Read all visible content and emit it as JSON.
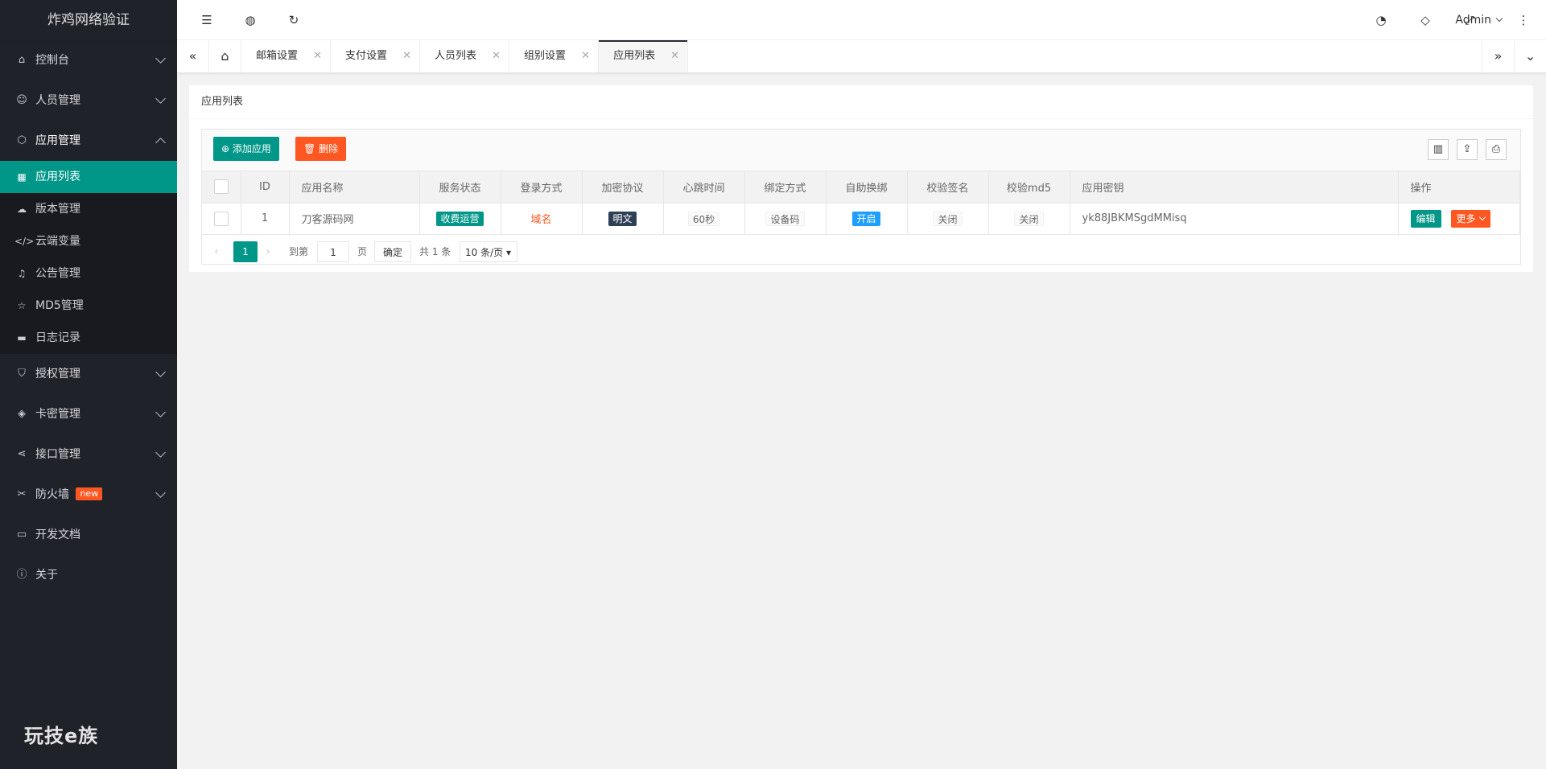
{
  "app": {
    "title": "炸鸡网络验证",
    "footer_brand": "玩技e族"
  },
  "sidebar": {
    "items": [
      {
        "label": "控制台",
        "icon": "home-icon"
      },
      {
        "label": "人员管理",
        "icon": "user-icon"
      },
      {
        "label": "应用管理",
        "icon": "cube-icon"
      },
      {
        "label": "授权管理",
        "icon": "shield-icon"
      },
      {
        "label": "卡密管理",
        "icon": "layers-icon"
      },
      {
        "label": "接口管理",
        "icon": "share-icon"
      },
      {
        "label": "防火墙",
        "icon": "tools-icon",
        "badge": "new"
      },
      {
        "label": "开发文档",
        "icon": "book-icon"
      },
      {
        "label": "关于",
        "icon": "info-icon"
      }
    ],
    "app_sub": [
      {
        "label": "应用列表",
        "icon": "app-list-icon"
      },
      {
        "label": "版本管理",
        "icon": "cloud-icon"
      },
      {
        "label": "云端变量",
        "icon": "code-icon"
      },
      {
        "label": "公告管理",
        "icon": "bell-icon"
      },
      {
        "label": "MD5管理",
        "icon": "star-icon"
      },
      {
        "label": "日志记录",
        "icon": "log-icon"
      }
    ]
  },
  "header": {
    "user": "Admin"
  },
  "tabs": [
    {
      "label": "邮箱设置"
    },
    {
      "label": "支付设置"
    },
    {
      "label": "人员列表"
    },
    {
      "label": "组别设置"
    },
    {
      "label": "应用列表"
    }
  ],
  "page": {
    "title": "应用列表"
  },
  "toolbar": {
    "add_label": "添加应用",
    "delete_label": "删除"
  },
  "table": {
    "headers": [
      "ID",
      "应用名称",
      "服务状态",
      "登录方式",
      "加密协议",
      "心跳时间",
      "绑定方式",
      "自助换绑",
      "校验签名",
      "校验md5",
      "应用密钥",
      "操作"
    ],
    "rows": [
      {
        "id": "1",
        "name": "刀客源码网",
        "status": "收费运营",
        "login": "域名",
        "protocol": "明文",
        "heartbeat": "60秒",
        "bind": "设备码",
        "self_rebind": "开启",
        "check_sign": "关闭",
        "check_md5": "关闭",
        "key": "yk88JBKMSgdMMisq",
        "edit": "编辑",
        "more": "更多"
      }
    ]
  },
  "pager": {
    "current": "1",
    "goto_label": "到第",
    "goto_value": "1",
    "page_unit": "页",
    "confirm": "确定",
    "total": "共 1 条",
    "per_page": "10 条/页"
  },
  "colors": {
    "accent": "#009688",
    "danger": "#ff5722",
    "sidebar": "#20222a",
    "info": "#1e9fff"
  }
}
